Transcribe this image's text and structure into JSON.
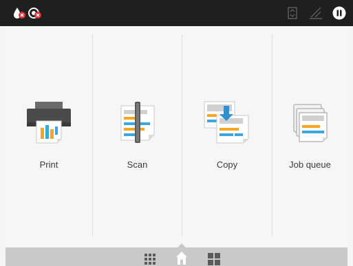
{
  "topbar": {
    "left_icons": [
      "ink-alert-icon",
      "printhead-alert-icon"
    ],
    "right_icons": [
      "paper-icon",
      "signal-icon",
      "pause-icon"
    ]
  },
  "tiles": [
    {
      "label": "Print",
      "icon": "printer-icon"
    },
    {
      "label": "Scan",
      "icon": "scanner-icon"
    },
    {
      "label": "Copy",
      "icon": "copy-icon"
    },
    {
      "label": "Job queue",
      "icon": "job-queue-icon"
    }
  ],
  "bottom_nav": [
    "apps-grid-icon",
    "home-icon",
    "widgets-icon"
  ],
  "colors": {
    "topbar": "#1f1f1f",
    "bottombar": "#c9c9c9",
    "accent_blue": "#3aa7e0",
    "accent_orange": "#f5a623"
  }
}
